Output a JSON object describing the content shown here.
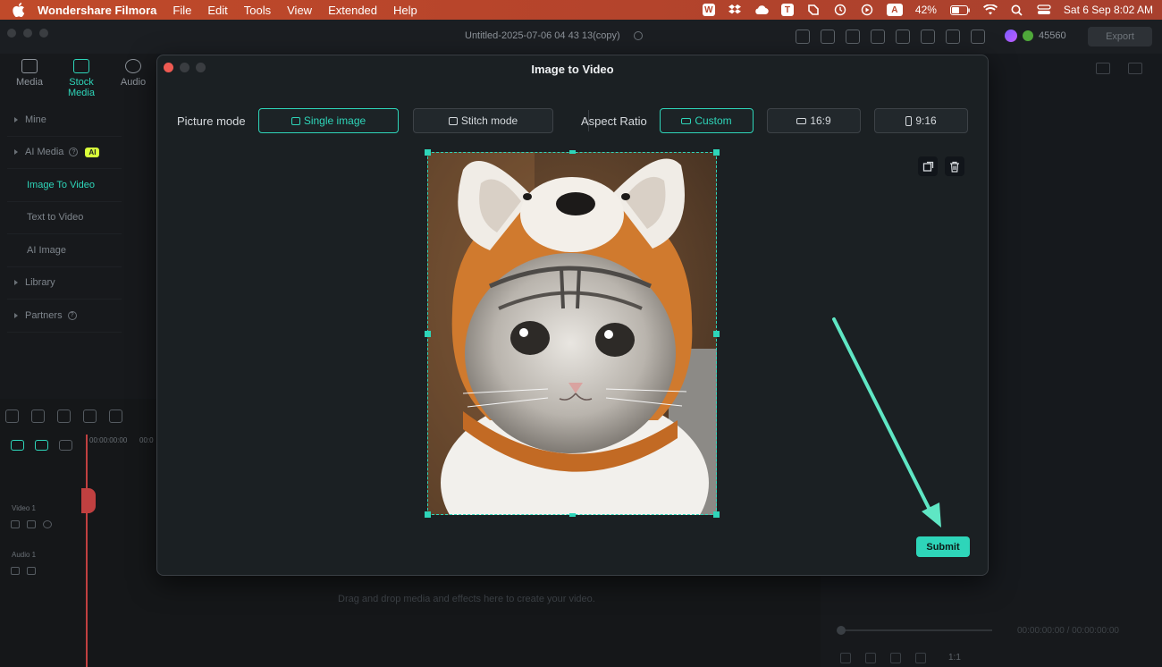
{
  "menubar": {
    "app_name": "Wondershare Filmora",
    "items": [
      "File",
      "Edit",
      "Tools",
      "View",
      "Extended",
      "Help"
    ],
    "battery": "42%",
    "datetime": "Sat 6 Sep  8:02 AM"
  },
  "window": {
    "document_title": "Untitled-2025-07-06 04 43 13(copy)",
    "credits": "45560",
    "export_label": "Export"
  },
  "left_panel": {
    "tabs": [
      {
        "label": "Media",
        "icon": "media-icon"
      },
      {
        "label": "Stock Media",
        "icon": "stock-media-icon"
      },
      {
        "label": "Audio",
        "icon": "music-note-icon"
      }
    ],
    "nav": {
      "mine": "Mine",
      "ai_media": "AI Media",
      "ai_badge": "AI",
      "image_to_video": "Image To Video",
      "text_to_video": "Text to Video",
      "ai_image": "AI Image",
      "library": "Library",
      "partners": "Partners"
    }
  },
  "timeline": {
    "timecode": "00:00:00:00",
    "timecode2": "00:0",
    "video_track": "Video 1",
    "audio_track": "Audio 1",
    "drop_hint": "Drag and drop media and effects here to create your video."
  },
  "player": {
    "time": "00:00:00:00   /   00:00:00:00",
    "ratio": "1:1"
  },
  "dialog": {
    "title": "Image to Video",
    "picture_mode_label": "Picture mode",
    "single_image": "Single image",
    "stitch_mode": "Stitch mode",
    "aspect_ratio_label": "Aspect Ratio",
    "custom": "Custom",
    "ratio_16_9": "16:9",
    "ratio_9_16": "9:16",
    "submit": "Submit"
  },
  "colors": {
    "accent": "#2ed5b9",
    "menubar": "#b8452b",
    "annotation_arrow": "#5fe6c4"
  }
}
